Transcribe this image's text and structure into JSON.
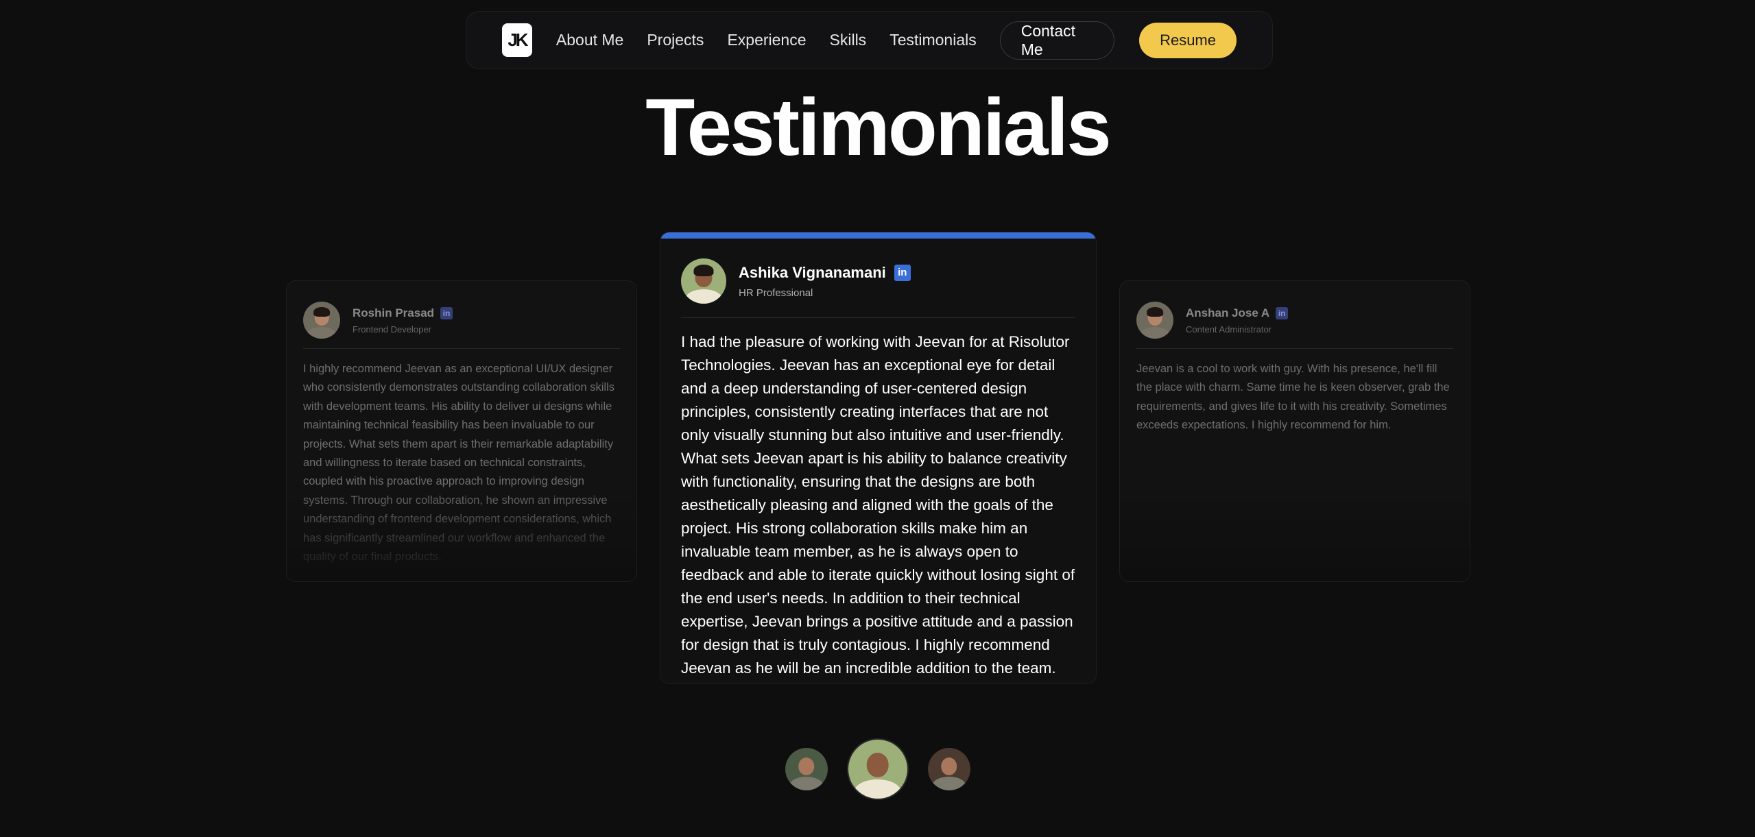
{
  "nav": {
    "logo_text": "JK",
    "links": [
      "About Me",
      "Projects",
      "Experience",
      "Skills",
      "Testimonials"
    ],
    "contact_label": "Contact Me",
    "resume_label": "Resume",
    "accent_color": "#f2c94c"
  },
  "section": {
    "title": "Testimonials"
  },
  "testimonials": {
    "left": {
      "name": "Roshin Prasad",
      "role": "Frontend Developer",
      "linkedin_icon": "in",
      "quote": "I highly recommend Jeevan as an exceptional UI/UX designer who consistently demonstrates outstanding collaboration skills with development teams. His ability to deliver ui designs while maintaining technical feasibility has been invaluable to our projects. What sets them apart is their remarkable adaptability and willingness to iterate based on technical constraints, coupled with his proactive approach to improving design systems. Through our collaboration, he shown an impressive understanding of frontend development considerations, which has significantly streamlined our workflow and enhanced the quality of our final products."
    },
    "center": {
      "name": "Ashika Vignanamani",
      "role": "HR Professional",
      "linkedin_icon": "in",
      "accent_color": "#3a6fd8",
      "quote": "I had the pleasure of working with Jeevan for at Risolutor Technologies. Jeevan has an exceptional eye for detail and a deep understanding of user-centered design principles, consistently creating interfaces that are not only visually stunning but also intuitive and user-friendly. What sets Jeevan apart is his ability to balance creativity with functionality, ensuring that the designs are both aesthetically pleasing and aligned with the goals of the project. His strong collaboration skills make him an invaluable team member, as he is always open to feedback and able to iterate quickly without losing sight of the end user's needs. In addition to their technical expertise, Jeevan brings a positive attitude and a passion for design that is truly contagious. I highly recommend Jeevan as he will be an incredible addition to the team."
    },
    "right": {
      "name": "Anshan Jose A",
      "role": "Content Administrator",
      "linkedin_icon": "in",
      "quote": "Jeevan is a cool to work with guy. With his presence, he'll fill the place with charm. Same time he is keen observer, grab the requirements, and gives life to it with his creativity. Sometimes exceeds expectations. I highly recommend for him."
    }
  }
}
